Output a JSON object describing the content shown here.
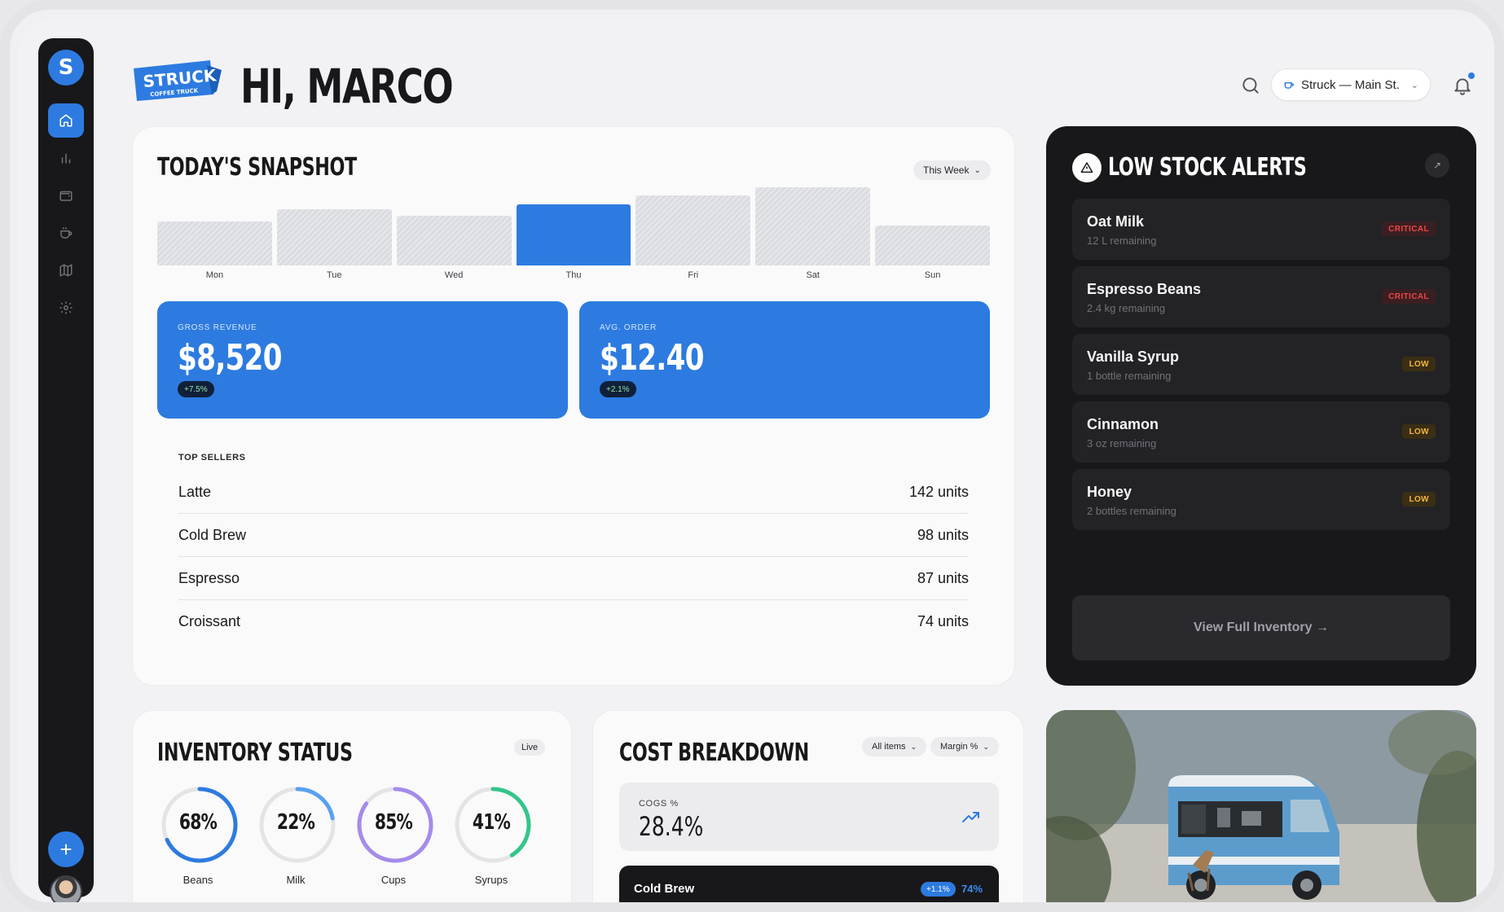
{
  "header": {
    "brand_name": "STRUCK",
    "brand_tagline": "COFFEE TRUCK",
    "greeting": "HI, MARCO",
    "location": "Struck — Main St.",
    "icons": [
      "search-icon",
      "bell-icon"
    ]
  },
  "sidebar": {
    "logo": "S",
    "items": [
      {
        "icon": "home-icon",
        "active": true
      },
      {
        "icon": "chart-icon",
        "active": false
      },
      {
        "icon": "wallet-icon",
        "active": false
      },
      {
        "icon": "coffee-cup-icon",
        "active": false
      },
      {
        "icon": "map-icon",
        "active": false
      },
      {
        "icon": "gear-icon",
        "active": false
      }
    ],
    "add_label": "+"
  },
  "snapshot": {
    "title": "TODAY'S SNAPSHOT",
    "period": "This Week",
    "chart_data": {
      "type": "bar",
      "categories": [
        "Mon",
        "Tue",
        "Wed",
        "Thu",
        "Fri",
        "Sat",
        "Sun"
      ],
      "values": [
        43,
        55,
        49,
        60,
        69,
        77,
        39
      ],
      "highlight": "Thu",
      "accent": "#2d7be0"
    },
    "kpis": [
      {
        "label": "GROSS REVENUE",
        "value": "$8,520",
        "change": "+7.5%"
      },
      {
        "label": "AVG. ORDER",
        "value": "$12.40",
        "change": "+2.1%"
      }
    ],
    "top_sellers_title": "TOP SELLERS",
    "top_sellers": [
      {
        "name": "Latte",
        "units": "142 units"
      },
      {
        "name": "Cold Brew",
        "units": "98 units"
      },
      {
        "name": "Espresso",
        "units": "87 units"
      },
      {
        "name": "Croissant",
        "units": "74 units"
      }
    ]
  },
  "alerts": {
    "title": "LOW STOCK ALERTS",
    "items": [
      {
        "name": "Oat Milk",
        "remaining": "12 L remaining",
        "level": "CRITICAL",
        "kind": "critical"
      },
      {
        "name": "Espresso Beans",
        "remaining": "2.4 kg remaining",
        "level": "CRITICAL",
        "kind": "critical"
      },
      {
        "name": "Vanilla Syrup",
        "remaining": "1 bottle remaining",
        "level": "LOW",
        "kind": "low"
      },
      {
        "name": "Cinnamon",
        "remaining": "3 oz remaining",
        "level": "LOW",
        "kind": "low"
      },
      {
        "name": "Honey",
        "remaining": "2 bottles remaining",
        "level": "LOW",
        "kind": "low"
      }
    ],
    "view_all": "View Full Inventory →",
    "colors": {
      "critical": "#ef4444",
      "low": "#f5b53d"
    }
  },
  "inventory": {
    "title": "INVENTORY STATUS",
    "status": "Live",
    "gauges": [
      {
        "name": "Beans",
        "label": "68%",
        "value": 0.68,
        "color": "#2d7be0"
      },
      {
        "name": "Milk",
        "label": "22%",
        "value": 0.22,
        "color": "#5aa0f0"
      },
      {
        "name": "Cups",
        "label": "85%",
        "value": 0.85,
        "color": "#a58bea"
      },
      {
        "name": "Syrups",
        "label": "41%",
        "value": 0.41,
        "color": "#34c58a"
      }
    ]
  },
  "cost": {
    "title": "COST BREAKDOWN",
    "filter_items": "All items",
    "filter_metric": "Margin %",
    "cogs_label": "COGS %",
    "cogs_value": "28.4%",
    "item": {
      "name": "Cold Brew",
      "change": "+1.1%",
      "margin": "74%",
      "fill": 0.74
    }
  }
}
